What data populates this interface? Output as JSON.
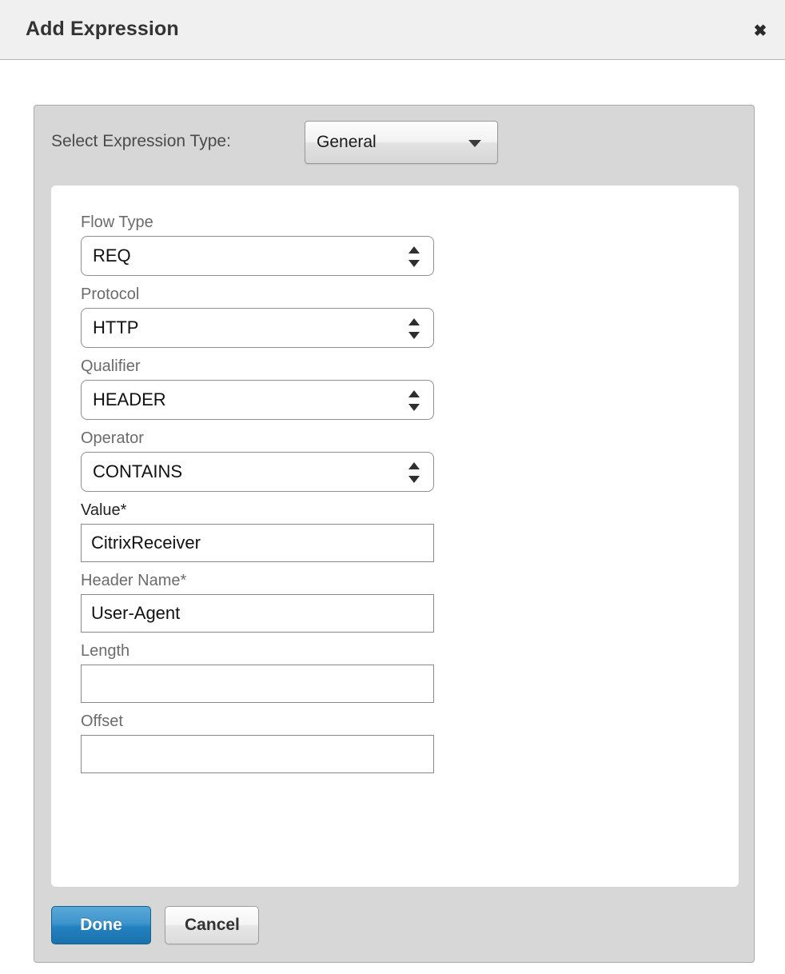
{
  "dialog": {
    "title": "Add Expression",
    "close_icon": "close-icon",
    "close_glyph": "✖"
  },
  "expression_type": {
    "label": "Select Expression Type:",
    "selected": "General",
    "caret_icon": "chevron-down-icon"
  },
  "fields": [
    {
      "label": "Flow Type",
      "value": "REQ",
      "control": "select"
    },
    {
      "label": "Protocol",
      "value": "HTTP",
      "control": "select"
    },
    {
      "label": "Qualifier",
      "value": "HEADER",
      "control": "select"
    },
    {
      "label": "Operator",
      "value": "CONTAINS",
      "control": "select"
    },
    {
      "label": "Value*",
      "value": "CitrixReceiver",
      "control": "input",
      "required": true
    },
    {
      "label": "Header Name*",
      "value": "User-Agent",
      "control": "input",
      "required": true
    },
    {
      "label": "Length",
      "value": "",
      "control": "input"
    },
    {
      "label": "Offset",
      "value": "",
      "control": "input"
    }
  ],
  "footer": {
    "done_label": "Done",
    "cancel_label": "Cancel"
  },
  "colors": {
    "header_bg": "#f0f0f0",
    "panel_bg": "#d7d7d7",
    "card_bg": "#ffffff",
    "primary_button": "#2381bf",
    "label_gray": "#6b6b6b",
    "label_dark": "#222222"
  }
}
